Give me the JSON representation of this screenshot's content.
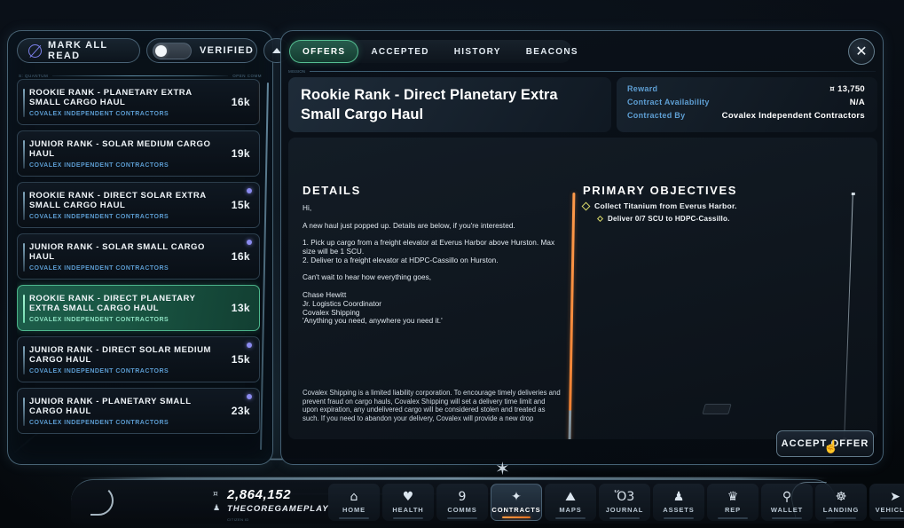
{
  "left_panel": {
    "toolbar": {
      "mark_all_read_label": "MARK ALL READ",
      "mark_all_read_icon": "mark-read-icon",
      "verified_label": "VERIFIED",
      "verified_toggle_state": "off",
      "collapse_icon": "chevron-up-icon",
      "divider_left_micro": "S: QUANTUM",
      "divider_right_micro": "OPEN COMM"
    },
    "missions": [
      {
        "title": "ROOKIE RANK - PLANETARY EXTRA SMALL CARGO HAUL",
        "contractor": "COVALEX INDEPENDENT CONTRACTORS",
        "reward": "16k",
        "unread": false,
        "selected": false,
        "accent": true
      },
      {
        "title": "JUNIOR RANK - SOLAR MEDIUM CARGO HAUL",
        "contractor": "COVALEX INDEPENDENT CONTRACTORS",
        "reward": "19k",
        "unread": false,
        "selected": false,
        "accent": false
      },
      {
        "title": "ROOKIE RANK - DIRECT SOLAR EXTRA SMALL CARGO HAUL",
        "contractor": "COVALEX INDEPENDENT CONTRACTORS",
        "reward": "15k",
        "unread": true,
        "selected": false,
        "accent": false
      },
      {
        "title": "JUNIOR RANK - SOLAR SMALL CARGO HAUL",
        "contractor": "COVALEX INDEPENDENT CONTRACTORS",
        "reward": "16k",
        "unread": true,
        "selected": false,
        "accent": false
      },
      {
        "title": "ROOKIE RANK - DIRECT PLANETARY EXTRA SMALL CARGO HAUL",
        "contractor": "COVALEX INDEPENDENT CONTRACTORS",
        "reward": "13k",
        "unread": false,
        "selected": true,
        "accent": false
      },
      {
        "title": "JUNIOR RANK - DIRECT SOLAR MEDIUM CARGO HAUL",
        "contractor": "COVALEX INDEPENDENT CONTRACTORS",
        "reward": "15k",
        "unread": true,
        "selected": false,
        "accent": false
      },
      {
        "title": "JUNIOR RANK - PLANETARY SMALL CARGO HAUL",
        "contractor": "COVALEX INDEPENDENT CONTRACTORS",
        "reward": "23k",
        "unread": true,
        "selected": false,
        "accent": false
      }
    ]
  },
  "right_panel": {
    "tabs": [
      {
        "label": "OFFERS",
        "active": true
      },
      {
        "label": "ACCEPTED",
        "active": false
      },
      {
        "label": "HISTORY",
        "active": false
      },
      {
        "label": "BEACONS",
        "active": false
      }
    ],
    "close_icon": "close-icon",
    "divider_left_micro": "MISSION",
    "mission_title": "Rookie Rank - Direct Planetary Extra Small Cargo Haul",
    "info": {
      "reward_label": "Reward",
      "reward_value": "13,750",
      "reward_currency_symbol": "¤",
      "availability_label": "Contract Availability",
      "availability_value": "N/A",
      "contracted_by_label": "Contracted By",
      "contracted_by_value": "Covalex Independent Contractors"
    },
    "details": {
      "heading": "DETAILS",
      "greeting": "Hi,",
      "intro": "A new haul just popped up. Details are below, if you're interested.",
      "step_1": "1. Pick up cargo from a freight elevator at Everus Harbor above Hurston. Max size will be 1 SCU.",
      "step_2": "2. Deliver to a freight elevator at HDPC-Cassillo on Hurston.",
      "closing": "Can't wait to hear how everything goes,",
      "signature_name": "Chase Hewitt",
      "signature_title": "Jr. Logistics Coordinator",
      "signature_company": "Covalex Shipping",
      "signature_motto": "'Anything you need, anywhere you need it.'",
      "legal": "Covalex Shipping is a limited liability corporation. To encourage timely deliveries and prevent fraud on cargo hauls, Covalex Shipping will set a delivery time limit and upon expiration, any undelivered cargo will be considered stolen and treated as such. If you need to abandon your delivery, Covalex will provide a new drop"
    },
    "objectives": {
      "heading": "PRIMARY OBJECTIVES",
      "items": [
        {
          "text": "Collect Titanium from Everus Harbor.",
          "sub": false
        },
        {
          "text": "Deliver 0/7 SCU to HDPC-Cassillo.",
          "sub": true
        }
      ]
    },
    "accept_offer_label": "ACCEPT OFFER"
  },
  "bottom_bar": {
    "credits": "2,864,152",
    "credits_icon": "currency-icon",
    "handle": "THECOREGAMEPLAY",
    "handle_icon": "user-icon",
    "micro": "CITIZEN ID",
    "nav": [
      {
        "label": "HOME",
        "icon": "home-icon",
        "glyph": "⌂",
        "active": false
      },
      {
        "label": "HEALTH",
        "icon": "heart-icon",
        "glyph": "♥",
        "active": false
      },
      {
        "label": "COMMS",
        "icon": "chat-icon",
        "glyph": "὞9",
        "active": false
      },
      {
        "label": "CONTRACTS",
        "icon": "contracts-icon",
        "glyph": "✦",
        "active": true
      },
      {
        "label": "MAPS",
        "icon": "map-icon",
        "glyph": "⛰",
        "active": false
      },
      {
        "label": "JOURNAL",
        "icon": "journal-icon",
        "glyph": "Ὅ3",
        "active": false
      },
      {
        "label": "ASSETS",
        "icon": "assets-icon",
        "glyph": "♟",
        "active": false
      },
      {
        "label": "REP",
        "icon": "rep-icon",
        "glyph": "♛",
        "active": false
      },
      {
        "label": "WALLET",
        "icon": "wallet-icon",
        "glyph": "⚲",
        "active": false
      },
      {
        "label": "LANDING",
        "icon": "landing-icon",
        "glyph": "☸",
        "active": false
      },
      {
        "label": "VEHICLES",
        "icon": "vehicles-icon",
        "glyph": "➤",
        "active": false
      }
    ]
  },
  "cursor": {
    "icon": "pointer-cursor-icon",
    "glyph": "☝"
  }
}
